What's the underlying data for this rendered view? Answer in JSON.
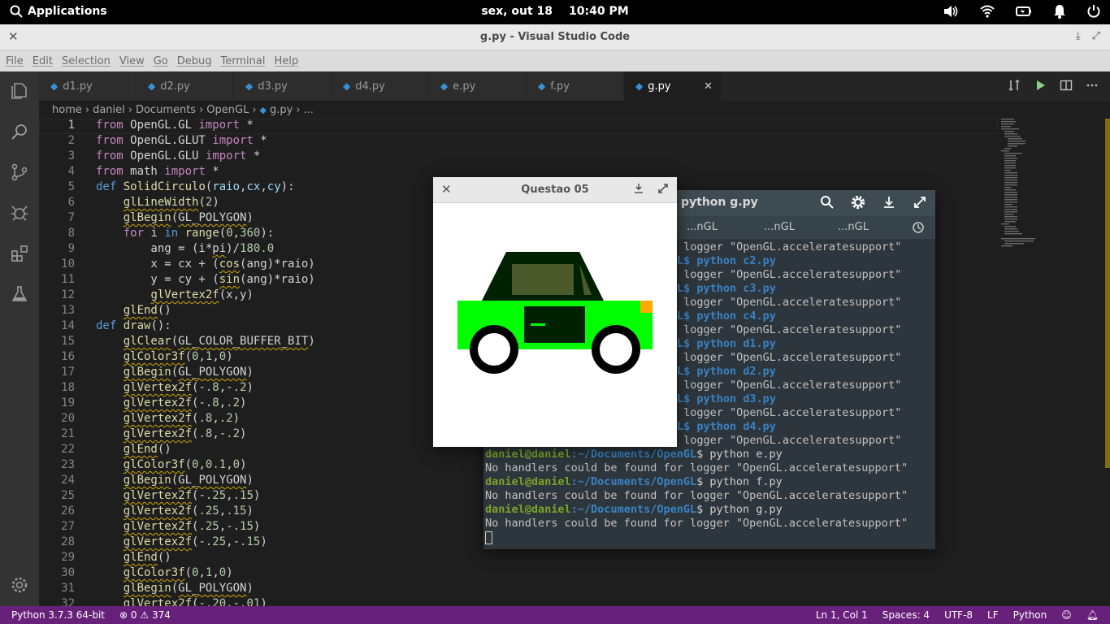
{
  "system_bar": {
    "apps_label": "Applications",
    "date": "sex, out 18",
    "time": "10:40 PM"
  },
  "window": {
    "title": "g.py - Visual Studio Code"
  },
  "menu": [
    "File",
    "Edit",
    "Selection",
    "View",
    "Go",
    "Debug",
    "Terminal",
    "Help"
  ],
  "tabs": [
    {
      "label": "d1.py"
    },
    {
      "label": "d2.py"
    },
    {
      "label": "d3.py"
    },
    {
      "label": "d4.py"
    },
    {
      "label": "e.py"
    },
    {
      "label": "f.py"
    },
    {
      "label": "g.py",
      "active": true
    }
  ],
  "breadcrumb": [
    "home",
    "daniel",
    "Documents",
    "OpenGL",
    "g.py",
    "..."
  ],
  "editor": {
    "line_numbers": [
      "1",
      "2",
      "3",
      "4",
      "5",
      "6",
      "7",
      "8",
      "9",
      "10",
      "11",
      "12",
      "13",
      "14",
      "15",
      "16",
      "17",
      "18",
      "19",
      "20",
      "21",
      "22",
      "23",
      "24",
      "25",
      "26",
      "27",
      "28",
      "29",
      "30",
      "31",
      "32"
    ]
  },
  "status_bar": {
    "python": "Python 3.7.3 64-bit",
    "errors": "0",
    "warnings": "374",
    "position": "Ln 1, Col 1",
    "spaces": "Spaces: 4",
    "encoding": "UTF-8",
    "eol": "LF",
    "language": "Python"
  },
  "terminal": {
    "title": "python g.py",
    "tabs": [
      "...nGL",
      "...nGL",
      "...nGL"
    ],
    "user": "daniel@daniel",
    "path": ":~/Documents/OpenGL",
    "partial_lines": [
      {
        "type": "msg",
        "text": " logger \"OpenGL.acceleratesupport\""
      },
      {
        "type": "cmd",
        "text": "L$ python c2.py"
      },
      {
        "type": "msg",
        "text": " logger \"OpenGL.acceleratesupport\""
      },
      {
        "type": "cmd",
        "text": "L$ python c3.py"
      },
      {
        "type": "msg",
        "text": " logger \"OpenGL.acceleratesupport\""
      },
      {
        "type": "cmd",
        "text": "L$ python c4.py"
      },
      {
        "type": "msg",
        "text": " logger \"OpenGL.acceleratesupport\""
      },
      {
        "type": "cmd",
        "text": "L$ python d1.py"
      },
      {
        "type": "msg",
        "text": " logger \"OpenGL.acceleratesupport\""
      },
      {
        "type": "cmd",
        "text": "L$ python d2.py"
      },
      {
        "type": "msg",
        "text": " logger \"OpenGL.acceleratesupport\""
      },
      {
        "type": "cmd",
        "text": "L$ python d3.py"
      },
      {
        "type": "msg",
        "text": " logger \"OpenGL.acceleratesupport\""
      },
      {
        "type": "cmd",
        "text": "L$ python d4.py"
      },
      {
        "type": "msg",
        "text": " logger \"OpenGL.acceleratesupport\""
      }
    ],
    "full_lines": [
      {
        "cmd": "$ python e.py",
        "msg": "No handlers could be found for logger \"OpenGL.acceleratesupport\""
      },
      {
        "cmd": "$ python f.py",
        "msg": "No handlers could be found for logger \"OpenGL.acceleratesupport\""
      },
      {
        "cmd": "$ python g.py",
        "msg": "No handlers could be found for logger \"OpenGL.acceleratesupport\""
      }
    ]
  },
  "gl_window": {
    "title": "Questao 05"
  },
  "colors": {
    "status_bar": "#68217a",
    "car_body": "#00ff00",
    "car_top": "#002200",
    "car_window": "#4a5a2a",
    "light": "#ffaa00"
  }
}
